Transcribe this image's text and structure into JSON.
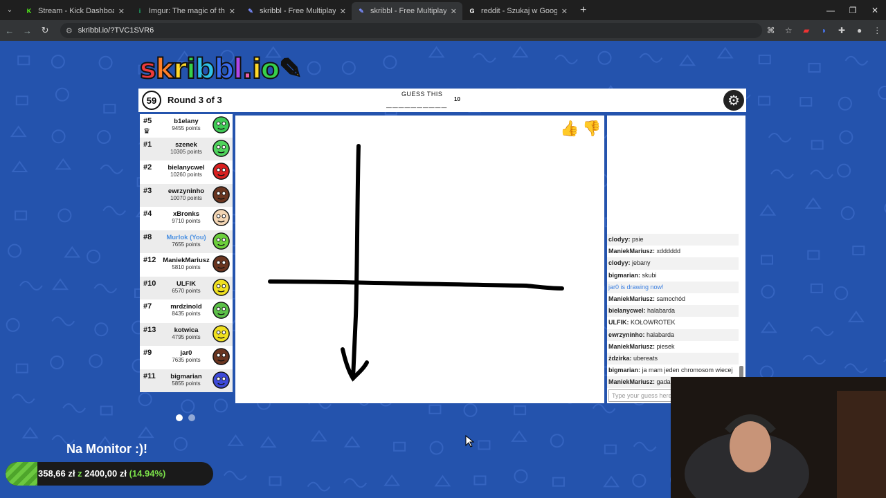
{
  "browser": {
    "tabs": [
      {
        "title": "Stream - Kick Dashboard",
        "favicon": "K",
        "color": "#53fc18",
        "active": false
      },
      {
        "title": "Imgur: The magic of the Interne",
        "favicon": "i",
        "color": "#1bb76e",
        "active": false
      },
      {
        "title": "skribbl - Free Multiplayer Drawi",
        "favicon": "✎",
        "color": "#7a8cff",
        "active": false
      },
      {
        "title": "skribbl - Free Multiplayer Drawi",
        "favicon": "✎",
        "color": "#7a8cff",
        "active": true
      },
      {
        "title": "reddit - Szukaj w Google",
        "favicon": "G",
        "color": "#ffffff",
        "active": false
      }
    ],
    "url": "skribbl.io/?TVC1SVR6"
  },
  "game": {
    "logo": "skribbl.io",
    "timer": "59",
    "round": "Round 3 of 3",
    "hint_label": "GUESS THIS",
    "word_blanks": "__________",
    "word_length": "10"
  },
  "players": [
    {
      "rank": "#5",
      "name": "b1elany",
      "points": "9455 points",
      "avatar": "#3fca55",
      "crown": true
    },
    {
      "rank": "#1",
      "name": "szenek",
      "points": "10305 points",
      "avatar": "#4fd35c"
    },
    {
      "rank": "#2",
      "name": "bielanycwel",
      "points": "10260 points",
      "avatar": "#d92020"
    },
    {
      "rank": "#3",
      "name": "ewrzyninho",
      "points": "10070 points",
      "avatar": "#6a3520"
    },
    {
      "rank": "#4",
      "name": "xBronks",
      "points": "9710 points",
      "avatar": "#f4d6b4"
    },
    {
      "rank": "#8",
      "name": "Murlok (You)",
      "points": "7655 points",
      "avatar": "#6ccf3c",
      "you": true
    },
    {
      "rank": "#12",
      "name": "ManiekMariusz",
      "points": "5810 points",
      "avatar": "#6a3520"
    },
    {
      "rank": "#10",
      "name": "ULFIK",
      "points": "6570 points",
      "avatar": "#f0e020"
    },
    {
      "rank": "#7",
      "name": "mrdzinold",
      "points": "8435 points",
      "avatar": "#5cc048"
    },
    {
      "rank": "#13",
      "name": "kotwica",
      "points": "4795 points",
      "avatar": "#f0e020"
    },
    {
      "rank": "#9",
      "name": "jar0",
      "points": "7635 points",
      "avatar": "#6a3520"
    },
    {
      "rank": "#11",
      "name": "bigmarian",
      "points": "5855 points",
      "avatar": "#3d4ad8"
    }
  ],
  "chat": {
    "messages": [
      {
        "user": "clodyy:",
        "text": " psie"
      },
      {
        "user": "ManiekMariusz:",
        "text": " xdddddd"
      },
      {
        "user": "clodyy:",
        "text": " jebany"
      },
      {
        "user": "bigmarian:",
        "text": " skubi"
      },
      {
        "user": "",
        "text": "jar0 is drawing now!",
        "system": true
      },
      {
        "user": "ManiekMariusz:",
        "text": " samochód"
      },
      {
        "user": "bielanycwel:",
        "text": " halabarda"
      },
      {
        "user": "ULFIK:",
        "text": " KOŁOWROTEK"
      },
      {
        "user": "ewrzyninho:",
        "text": " halabarda"
      },
      {
        "user": "ManiekMariusz:",
        "text": " piesek"
      },
      {
        "user": "żdzirka:",
        "text": " ubereats"
      },
      {
        "user": "bigmarian:",
        "text": " ja mam jeden chromosom wiecej"
      },
      {
        "user": "ManiekMariusz:",
        "text": " gada"
      }
    ],
    "placeholder": "Type your guess here..."
  },
  "overlay": {
    "donation_title": "Na Monitor :)!",
    "donation_current": "358,66 zł",
    "donation_sep": " z ",
    "donation_goal": "2400,00 zł",
    "donation_pct": "(14.94%)",
    "donation_fraction": 0.1494
  },
  "colors": {
    "accent_blue": "#2453ad",
    "you_name": "#4a90e2",
    "system_msg": "#3b7fe0"
  }
}
